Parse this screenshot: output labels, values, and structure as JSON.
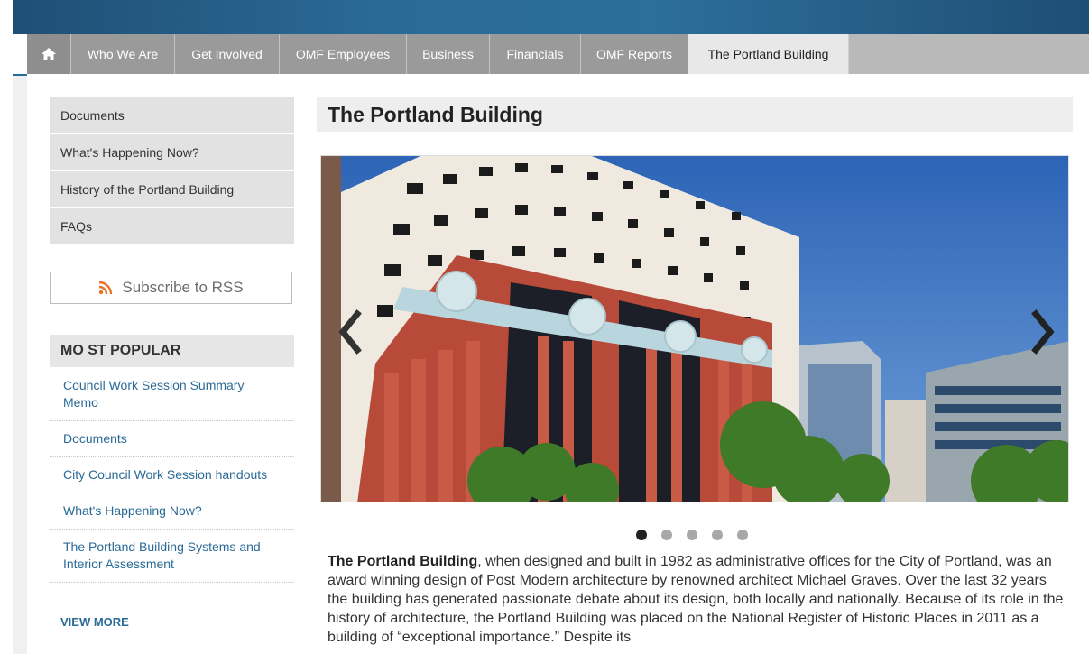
{
  "nav": {
    "home_icon": "home-icon",
    "items": [
      "Who We Are",
      "Get Involved",
      "OMF Employees",
      "Business",
      "Financials",
      "OMF Reports",
      "The Portland Building"
    ],
    "active": "The Portland Building"
  },
  "sidebar": {
    "menu": [
      "Documents",
      "What's Happening Now?",
      "History of the Portland Building",
      "FAQs"
    ],
    "rss_label": "Subscribe to RSS",
    "popular_heading": "MO ST POPULAR",
    "popular": [
      "Council Work Session Summary Memo",
      "Documents",
      "City Council Work Session handouts",
      "What's Happening Now?",
      "The Portland Building Systems and Interior Assessment"
    ],
    "view_more": "VIEW MORE"
  },
  "main": {
    "title": "The Portland Building",
    "slide_count": 5,
    "active_slide": 1,
    "body_bold": "The Portland Building",
    "body_text": ", when designed and built in 1982 as administrative offices for the City of Portland, was an award winning design of Post Modern architecture by renowned architect Michael Graves.  Over the last 32 years the building has generated passionate debate about its design, both locally and nationally. Because of its role in the history of architecture, the Portland Building was placed on the National Register of Historic Places in 2011 as a building of “exceptional importance.” Despite its"
  },
  "colors": {
    "brand_blue": "#2a6a96",
    "nav_gray": "#9a9a9a",
    "active_tab": "#e8e8e8",
    "rss_orange": "#e8742a"
  }
}
